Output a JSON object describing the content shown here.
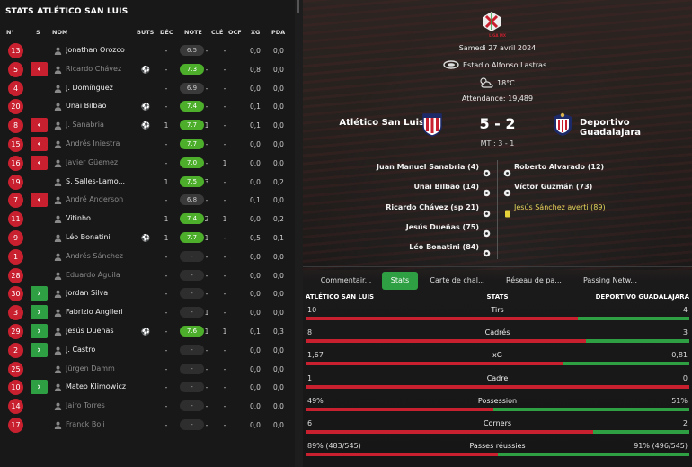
{
  "left": {
    "title": "STATS ATLÉTICO SAN LUIS",
    "columns": [
      "N°",
      "S",
      "NOM",
      "BUTS",
      "DÉC",
      "NOTE",
      "CLÉ",
      "OCF",
      "XG",
      "PDA"
    ],
    "players": [
      {
        "num": "13",
        "sub": "",
        "name": "Jonathan Orozco",
        "active": true,
        "goal": false,
        "buts": "",
        "dec": "-",
        "note": "6.5",
        "rating": "mid",
        "cle": "-",
        "ocf": "-",
        "xg": "0,0",
        "pda": "0,0"
      },
      {
        "num": "5",
        "sub": "out",
        "name": "Ricardo Chávez",
        "active": false,
        "goal": true,
        "buts": "",
        "dec": "-",
        "note": "7.3",
        "rating": "good",
        "cle": "-",
        "ocf": "-",
        "xg": "0,8",
        "pda": "0,0"
      },
      {
        "num": "4",
        "sub": "",
        "name": "J. Domínguez",
        "active": true,
        "goal": false,
        "buts": "",
        "dec": "-",
        "note": "6.9",
        "rating": "mid",
        "cle": "-",
        "ocf": "-",
        "xg": "0,0",
        "pda": "0,0"
      },
      {
        "num": "20",
        "sub": "",
        "name": "Unai Bilbao",
        "active": true,
        "goal": true,
        "buts": "",
        "dec": "-",
        "note": "7.4",
        "rating": "good",
        "cle": "-",
        "ocf": "-",
        "xg": "0,1",
        "pda": "0,0"
      },
      {
        "num": "8",
        "sub": "out",
        "name": "J. Sanabria",
        "active": false,
        "goal": true,
        "buts": "",
        "dec": "1",
        "note": "7.7",
        "rating": "good",
        "cle": "1",
        "ocf": "-",
        "xg": "0,1",
        "pda": "0,0"
      },
      {
        "num": "15",
        "sub": "out",
        "name": "Andrés Iniestra",
        "active": false,
        "goal": false,
        "buts": "",
        "dec": "-",
        "note": "7.7",
        "rating": "good",
        "cle": "-",
        "ocf": "-",
        "xg": "0,0",
        "pda": "0,0"
      },
      {
        "num": "16",
        "sub": "out",
        "name": "Javier Güemez",
        "active": false,
        "goal": false,
        "buts": "",
        "dec": "-",
        "note": "7.0",
        "rating": "good",
        "cle": "-",
        "ocf": "1",
        "xg": "0,0",
        "pda": "0,0"
      },
      {
        "num": "19",
        "sub": "",
        "name": "S. Salles-Lamo...",
        "active": true,
        "goal": false,
        "buts": "",
        "dec": "1",
        "note": "7.5",
        "rating": "good",
        "cle": "3",
        "ocf": "-",
        "xg": "0,0",
        "pda": "0,2"
      },
      {
        "num": "7",
        "sub": "out",
        "name": "André Anderson",
        "active": false,
        "goal": false,
        "buts": "",
        "dec": "-",
        "note": "6.8",
        "rating": "mid",
        "cle": "-",
        "ocf": "-",
        "xg": "0,1",
        "pda": "0,0"
      },
      {
        "num": "11",
        "sub": "",
        "name": "Vitinho",
        "active": true,
        "goal": false,
        "buts": "",
        "dec": "1",
        "note": "7.4",
        "rating": "good",
        "cle": "2",
        "ocf": "1",
        "xg": "0,0",
        "pda": "0,2"
      },
      {
        "num": "9",
        "sub": "",
        "name": "Léo Bonatini",
        "active": true,
        "goal": true,
        "buts": "",
        "dec": "1",
        "note": "7.7",
        "rating": "good",
        "cle": "1",
        "ocf": "-",
        "xg": "0,5",
        "pda": "0,1"
      },
      {
        "num": "1",
        "sub": "",
        "name": "Andrés Sánchez",
        "active": false,
        "goal": false,
        "buts": "",
        "dec": "-",
        "note": "-",
        "rating": "none",
        "cle": "-",
        "ocf": "-",
        "xg": "0,0",
        "pda": "0,0"
      },
      {
        "num": "28",
        "sub": "",
        "name": "Eduardo Águila",
        "active": false,
        "goal": false,
        "buts": "",
        "dec": "-",
        "note": "-",
        "rating": "none",
        "cle": "-",
        "ocf": "-",
        "xg": "0,0",
        "pda": "0,0"
      },
      {
        "num": "30",
        "sub": "in",
        "name": "Jordan Silva",
        "active": true,
        "goal": false,
        "buts": "",
        "dec": "-",
        "note": "-",
        "rating": "none",
        "cle": "-",
        "ocf": "-",
        "xg": "0,0",
        "pda": "0,0"
      },
      {
        "num": "3",
        "sub": "in",
        "name": "Fabrizio Angileri",
        "active": true,
        "goal": false,
        "buts": "",
        "dec": "-",
        "note": "-",
        "rating": "none",
        "cle": "1",
        "ocf": "-",
        "xg": "0,0",
        "pda": "0,0"
      },
      {
        "num": "29",
        "sub": "in",
        "name": "Jesús Dueñas",
        "active": true,
        "goal": true,
        "buts": "",
        "dec": "-",
        "note": "7.6",
        "rating": "good",
        "cle": "1",
        "ocf": "1",
        "xg": "0,1",
        "pda": "0,3"
      },
      {
        "num": "2",
        "sub": "in",
        "name": "J. Castro",
        "active": true,
        "goal": false,
        "buts": "",
        "dec": "-",
        "note": "-",
        "rating": "none",
        "cle": "-",
        "ocf": "-",
        "xg": "0,0",
        "pda": "0,0"
      },
      {
        "num": "25",
        "sub": "",
        "name": "Jürgen Damm",
        "active": false,
        "goal": false,
        "buts": "",
        "dec": "-",
        "note": "-",
        "rating": "none",
        "cle": "-",
        "ocf": "-",
        "xg": "0,0",
        "pda": "0,0"
      },
      {
        "num": "10",
        "sub": "in",
        "name": "Mateo Klimowicz",
        "active": true,
        "goal": false,
        "buts": "",
        "dec": "-",
        "note": "-",
        "rating": "none",
        "cle": "-",
        "ocf": "-",
        "xg": "0,0",
        "pda": "0,0"
      },
      {
        "num": "14",
        "sub": "",
        "name": "Jairo Torres",
        "active": false,
        "goal": false,
        "buts": "",
        "dec": "-",
        "note": "-",
        "rating": "none",
        "cle": "-",
        "ocf": "-",
        "xg": "0,0",
        "pda": "0,0"
      },
      {
        "num": "17",
        "sub": "",
        "name": "Franck Boli",
        "active": false,
        "goal": false,
        "buts": "",
        "dec": "-",
        "note": "-",
        "rating": "none",
        "cle": "-",
        "ocf": "-",
        "xg": "0,0",
        "pda": "0,0"
      }
    ]
  },
  "match": {
    "league_logo_text": "LIGA MX",
    "date": "Samedi 27 avril 2024",
    "stadium": "Estadio Alfonso Lastras",
    "temperature": "18°C",
    "attendance": "Attendance: 19,489",
    "home_team": "Atlético San Luis",
    "away_team": "Deportivo Guadalajara",
    "score": "5 - 2",
    "halftime": "MT : 3 - 1",
    "home_events": [
      "Juan Manuel Sanabria (4)",
      "Unai Bilbao (14)",
      "Ricardo Chávez (sp 21)",
      "Jesús Dueñas (75)",
      "Léo Bonatini (84)"
    ],
    "away_events": [
      {
        "text": "Roberto Alvarado (12)",
        "type": "goal"
      },
      {
        "text": "Víctor Guzmán (73)",
        "type": "goal"
      },
      {
        "text": "Jesús Sánchez averti (89)",
        "type": "card"
      }
    ]
  },
  "tabs": [
    "Commentair...",
    "Stats",
    "Carte de chal...",
    "Réseau de pa...",
    "Passing Netw..."
  ],
  "active_tab": "Stats",
  "stats_header": {
    "home": "ATLÉTICO SAN LUIS",
    "center": "STATS",
    "away": "DEPORTIVO GUADALAJARA"
  },
  "stats": [
    {
      "label": "Tirs",
      "home": "10",
      "away": "4",
      "home_share": 0.71
    },
    {
      "label": "Cadrés",
      "home": "8",
      "away": "3",
      "home_share": 0.73
    },
    {
      "label": "xG",
      "home": "1,67",
      "away": "0,81",
      "home_share": 0.67
    },
    {
      "label": "Cadre",
      "home": "1",
      "away": "0",
      "home_share": 1.0
    },
    {
      "label": "Possession",
      "home": "49%",
      "away": "51%",
      "home_share": 0.49
    },
    {
      "label": "Corners",
      "home": "6",
      "away": "2",
      "home_share": 0.75
    },
    {
      "label": "Passes réussies",
      "home": "89% (483/545)",
      "away": "91% (496/545)",
      "home_share": 0.5
    }
  ],
  "colors": {
    "red": "#c8202f",
    "green": "#2ea043",
    "rating_green": "#4cae2a"
  }
}
